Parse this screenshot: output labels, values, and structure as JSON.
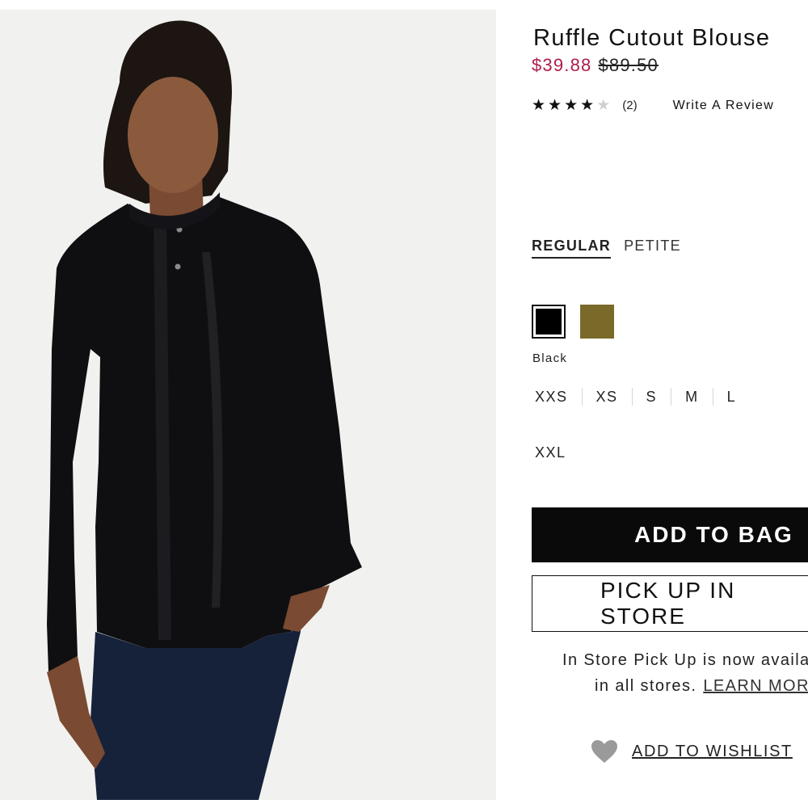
{
  "product": {
    "title": "Ruffle Cutout Blouse",
    "price_sale": "$39.88",
    "price_original": "$89.50",
    "rating": {
      "value": 4,
      "max": 5,
      "count_label": "(2)"
    },
    "write_review_label": "Write A Review"
  },
  "fit_tabs": [
    {
      "label": "REGULAR",
      "active": true
    },
    {
      "label": "PETITE",
      "active": false
    }
  ],
  "colors": {
    "swatches": [
      {
        "name": "Black",
        "hex": "#000000",
        "selected": true
      },
      {
        "name": "Olive",
        "hex": "#7a6a2a",
        "selected": false
      }
    ],
    "selected_label": "Black"
  },
  "sizes": {
    "row1": [
      "XXS",
      "XS",
      "S",
      "M",
      "L"
    ],
    "row2": [
      "XXL"
    ]
  },
  "actions": {
    "add_to_bag": "ADD TO BAG",
    "pick_up_in_store": "PICK UP IN STORE",
    "pickup_note_line1": "In Store Pick Up is now available",
    "pickup_note_line2": "in all stores.",
    "learn_more": "LEARN MORE",
    "add_to_wishlist": "ADD TO WISHLIST"
  },
  "icons": {
    "wishlist": "heart-icon",
    "star": "star-icon"
  },
  "theme": {
    "sale_color": "#b01c4a",
    "button_dark": "#0a0a0a",
    "wishlist_icon_color": "#9a9a9a"
  }
}
